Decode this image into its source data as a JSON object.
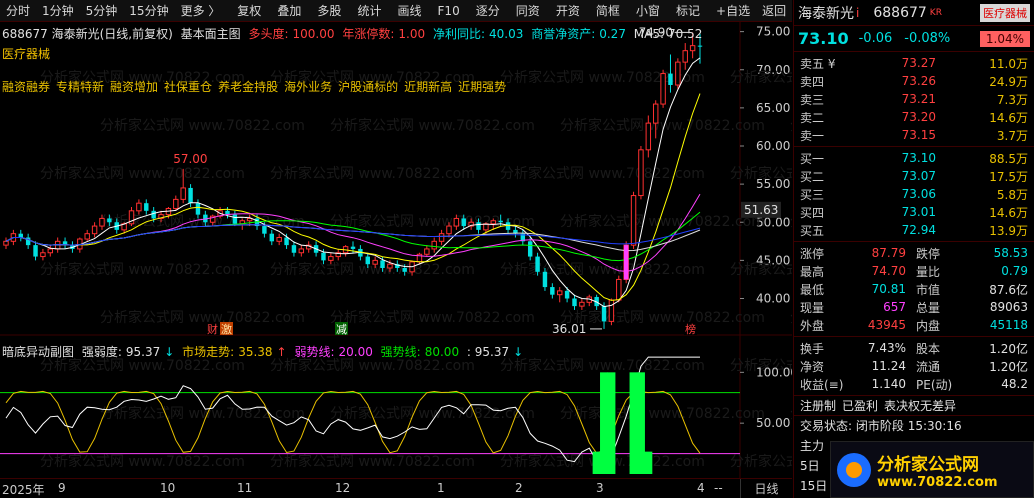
{
  "toolbar": {
    "left": [
      "分时",
      "1分钟",
      "5分钟",
      "15分钟",
      "更多 〉"
    ],
    "mid": [
      "复权",
      "叠加",
      "多股",
      "统计",
      "画线",
      "F10",
      "逐分",
      "同资",
      "开资",
      "简框",
      "小窗",
      "标记",
      "+自选"
    ],
    "back": "返回"
  },
  "main": {
    "info": {
      "code_name": "688677 海泰新光(日线,前复权)",
      "indicator": "基本面主图",
      "duo_label": "多头度:",
      "duo_val": "100.00",
      "zhang_label": "年涨停数:",
      "zhang_val": "1.00",
      "profit_label": "净利同比:",
      "profit_val": "40.03",
      "goodwill_label": "商誉净资产:",
      "goodwill_val": "0.27",
      "ma5_label": "MA5:",
      "ma5_val": "70.52"
    },
    "sector": "医疗器械",
    "concepts": [
      "融资融券",
      "专精特新",
      "融资增加",
      "社保重仓",
      "养老金持股",
      "海外业务",
      "沪股通标的",
      "近期新高",
      "近期强势"
    ],
    "annotations": {
      "high_label": "57.00",
      "low_label": "36.01",
      "peak_label": "74.90",
      "current_label": "51.63"
    },
    "markers": {
      "cai": "财",
      "ji": "激",
      "jian": "减",
      "bang": "榜"
    },
    "price_ticks": [
      "75.00",
      "70.00",
      "65.00",
      "60.00",
      "55.00",
      "50.00",
      "45.00",
      "40.00"
    ],
    "sub": {
      "title": "暗底异动副图",
      "strength_label": "强弱度:",
      "strength_val": "95.37",
      "market_label": "市场走势:",
      "market_val": "35.38",
      "weak_label": "弱势线:",
      "weak_val": "20.00",
      "strong_label": "强势线:",
      "strong_val": "80.00",
      "extra_val": ": 95.37",
      "ticks": [
        "100.00",
        "50.00"
      ]
    }
  },
  "time_axis": {
    "months": [
      "2025年",
      "9",
      "10",
      "11",
      "12",
      "1",
      "2",
      "3",
      "4",
      "--"
    ],
    "daily": "日线"
  },
  "quote": {
    "name": "海泰新光",
    "name_mark": "i",
    "code": "688677",
    "industry": "医疗器械",
    "last": "73.10",
    "change": "-0.06",
    "pct": "-0.08%",
    "badge": "1.04%",
    "asks": [
      {
        "label": "卖五 ¥",
        "price": "73.27",
        "vol": "11.0万"
      },
      {
        "label": "卖四",
        "price": "73.26",
        "vol": "24.9万"
      },
      {
        "label": "卖三",
        "price": "73.21",
        "vol": "7.3万"
      },
      {
        "label": "卖二",
        "price": "73.20",
        "vol": "14.6万"
      },
      {
        "label": "卖一",
        "price": "73.15",
        "vol": "3.7万"
      }
    ],
    "bids": [
      {
        "label": "买一",
        "price": "73.10",
        "vol": "88.5万"
      },
      {
        "label": "买二",
        "price": "73.07",
        "vol": "17.5万"
      },
      {
        "label": "买三",
        "price": "73.06",
        "vol": "5.8万"
      },
      {
        "label": "买四",
        "price": "73.01",
        "vol": "14.6万"
      },
      {
        "label": "买五",
        "price": "72.94",
        "vol": "13.9万"
      }
    ],
    "stats": [
      {
        "l": "涨停",
        "v": "87.79",
        "vc": "red",
        "l2": "跌停",
        "v2": "58.53",
        "v2c": "cyan"
      },
      {
        "l": "最高",
        "v": "74.70",
        "vc": "red",
        "l2": "量比",
        "v2": "0.79",
        "v2c": "cyan"
      },
      {
        "l": "最低",
        "v": "70.81",
        "vc": "cyan",
        "l2": "市值",
        "v2": "87.6亿",
        "v2c": "white"
      },
      {
        "l": "现量",
        "v": "657",
        "vc": "mag",
        "l2": "总量",
        "v2": "89063",
        "v2c": "white"
      },
      {
        "l": "外盘",
        "v": "43945",
        "vc": "red",
        "l2": "内盘",
        "v2": "45118",
        "v2c": "cyan"
      }
    ],
    "stats2": [
      {
        "l": "换手",
        "v": "7.43%",
        "l2": "股本",
        "v2": "1.20亿"
      },
      {
        "l": "净资",
        "v": "11.24",
        "l2": "流通",
        "v2": "1.20亿"
      },
      {
        "l": "收益(≡)",
        "v": "1.140",
        "l2": "PE(动)",
        "v2": "48.2"
      }
    ],
    "tags": [
      "注册制",
      "已盈利",
      "表决权无差异"
    ],
    "trade_label": "交易状态:",
    "trade_val": "闭市阶段 15:30:16",
    "trade2": "主力",
    "trade3": "5日",
    "trade4": "15日"
  },
  "logo": {
    "cn": "分析家公式网",
    "url": "www.70822.com"
  },
  "chart_data": {
    "type": "candlestick",
    "title": "海泰新光(日线,前复权)",
    "price_range": [
      36,
      76
    ],
    "x": [
      "2025-08",
      "2025-09",
      "2025-10",
      "2025-11",
      "2025-12",
      "2026-01",
      "2026-02",
      "2026-03",
      "2026-04"
    ],
    "candles": [
      [
        47,
        48,
        46.5,
        47.5
      ],
      [
        47.5,
        49,
        47,
        48.5
      ],
      [
        48.5,
        49,
        47.5,
        48
      ],
      [
        48,
        48.5,
        46.5,
        47
      ],
      [
        47,
        47.5,
        45,
        45.5
      ],
      [
        45.5,
        46.5,
        45,
        46
      ],
      [
        46,
        47,
        45.5,
        46.5
      ],
      [
        46.5,
        48,
        46,
        47.5
      ],
      [
        47.5,
        48,
        46.5,
        47
      ],
      [
        47,
        47.5,
        46,
        46.5
      ],
      [
        46.5,
        48,
        46,
        47.8
      ],
      [
        47.8,
        49,
        47.5,
        48.5
      ],
      [
        48.5,
        50,
        48,
        49.5
      ],
      [
        49.5,
        51,
        49,
        50.5
      ],
      [
        50.5,
        51,
        49.5,
        50
      ],
      [
        50,
        50.5,
        48.5,
        49
      ],
      [
        49,
        50,
        48.5,
        49.8
      ],
      [
        49.8,
        52,
        49.5,
        51.5
      ],
      [
        51.5,
        53,
        51,
        52.5
      ],
      [
        52.5,
        53,
        51,
        51.5
      ],
      [
        51.5,
        52,
        50,
        50.5
      ],
      [
        50.5,
        51.5,
        50,
        51
      ],
      [
        51,
        52,
        50.5,
        51.8
      ],
      [
        51.8,
        53.5,
        51.5,
        53
      ],
      [
        53,
        57,
        52.5,
        54.5
      ],
      [
        54.5,
        55,
        52,
        52.5
      ],
      [
        52.5,
        53,
        50.5,
        51
      ],
      [
        51,
        51.5,
        49.5,
        50
      ],
      [
        50,
        51,
        49.5,
        50.8
      ],
      [
        50.8,
        52,
        50.5,
        51.5
      ],
      [
        51.5,
        52,
        50.5,
        51
      ],
      [
        51,
        51.5,
        49.5,
        49.8
      ],
      [
        49.8,
        50.5,
        49,
        50.2
      ],
      [
        50.2,
        51,
        49.5,
        50.5
      ],
      [
        50.5,
        51,
        49,
        49.5
      ],
      [
        49.5,
        50,
        48,
        48.5
      ],
      [
        48.5,
        49,
        47,
        47.5
      ],
      [
        47.5,
        48.5,
        47,
        48
      ],
      [
        48,
        48.5,
        46.5,
        47
      ],
      [
        47,
        47.5,
        45.5,
        46
      ],
      [
        46,
        47,
        45.5,
        46.5
      ],
      [
        46.5,
        47.5,
        46,
        47
      ],
      [
        47,
        47.5,
        45.5,
        46
      ],
      [
        46,
        46.5,
        44.5,
        45
      ],
      [
        45,
        46,
        44.5,
        45.5
      ],
      [
        45.5,
        46.5,
        45,
        46
      ],
      [
        46,
        47,
        45.5,
        46.8
      ],
      [
        46.8,
        47.5,
        46,
        46.5
      ],
      [
        46.5,
        47,
        45,
        45.5
      ],
      [
        45.5,
        46,
        44,
        44.5
      ],
      [
        44.5,
        45.5,
        44,
        45
      ],
      [
        45,
        45.5,
        43.5,
        44
      ],
      [
        44,
        45,
        43.5,
        44.5
      ],
      [
        44.5,
        45,
        43.5,
        44
      ],
      [
        44,
        44.5,
        43,
        43.5
      ],
      [
        43.5,
        45,
        43,
        44.8
      ],
      [
        44.8,
        46,
        44.5,
        45.8
      ],
      [
        45.8,
        47,
        45.5,
        46.5
      ],
      [
        46.5,
        48,
        46,
        47.5
      ],
      [
        47.5,
        49,
        47,
        48.5
      ],
      [
        48.5,
        50,
        48,
        49.5
      ],
      [
        49.5,
        51,
        49,
        50.5
      ],
      [
        50.5,
        51,
        49,
        49.5
      ],
      [
        49.5,
        50.5,
        49,
        50
      ],
      [
        50,
        50.5,
        48.5,
        49
      ],
      [
        49,
        50,
        48.5,
        49.8
      ],
      [
        49.8,
        50.5,
        49,
        50.2
      ],
      [
        50.2,
        51,
        49.5,
        50
      ],
      [
        50,
        50.5,
        48.5,
        49
      ],
      [
        49,
        49.5,
        48,
        48.5
      ],
      [
        48.5,
        49,
        47,
        47.5
      ],
      [
        47.5,
        48,
        45,
        45.5
      ],
      [
        45.5,
        46,
        43,
        43.5
      ],
      [
        43.5,
        44,
        41,
        41.5
      ],
      [
        41.5,
        42,
        40,
        40.5
      ],
      [
        40.5,
        41.5,
        39.5,
        41
      ],
      [
        41,
        41.5,
        39.5,
        40
      ],
      [
        40,
        40.5,
        38.5,
        39
      ],
      [
        39,
        40,
        38.5,
        39.5
      ],
      [
        39.5,
        40.5,
        39,
        40.2
      ],
      [
        40.2,
        40.5,
        38.5,
        39
      ],
      [
        39,
        39.5,
        36.01,
        37
      ],
      [
        37,
        40,
        36.5,
        39.8
      ],
      [
        39.8,
        43,
        39.5,
        42.5
      ],
      [
        42.5,
        47.5,
        42,
        47
      ],
      [
        47,
        54,
        46.5,
        53.5
      ],
      [
        53.5,
        60,
        53,
        59.5
      ],
      [
        59.5,
        64,
        58.5,
        63
      ],
      [
        63,
        66,
        61,
        65.5
      ],
      [
        65.5,
        70,
        65,
        69.5
      ],
      [
        69.5,
        72,
        67,
        68
      ],
      [
        68,
        71.5,
        67.5,
        71
      ],
      [
        71,
        73.5,
        70,
        72.5
      ],
      [
        72.5,
        74.9,
        71.5,
        73.16
      ],
      [
        73.16,
        74.7,
        70.81,
        73.1
      ]
    ],
    "sub_series": {
      "strength_line": 95.37,
      "weak_line": 20,
      "strong_line": 80
    }
  }
}
